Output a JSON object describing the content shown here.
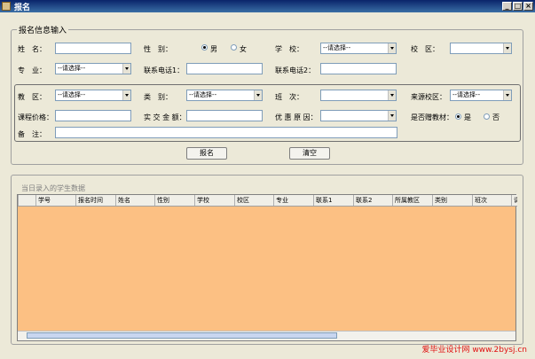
{
  "window": {
    "title": "报名",
    "min": "_",
    "max": "□",
    "close": "×"
  },
  "reg_group": {
    "legend": "报名信息输入"
  },
  "fields": {
    "name_label": "姓　名：",
    "gender_label": "性　别：",
    "gender_male": "男",
    "gender_female": "女",
    "school_label": "学　校：",
    "school_value": "--请选择--",
    "campus_label": "校　区：",
    "campus_value": "",
    "major_label": "专　业：",
    "major_value": "--请选择--",
    "phone1_label": "联系电话1：",
    "phone2_label": "联系电话2：",
    "dept_label": "教　区：",
    "dept_value": "--请选择--",
    "type_label": "类　别：",
    "type_value": "--请选择--",
    "class_label": "班　次：",
    "class_value": "",
    "source_label": "来源校区：",
    "source_value": "--请选择--",
    "price_label": "课程价格：",
    "paid_label": "实 交 金 额：",
    "discount_label": "优 惠 原 因：",
    "discount_value": "",
    "material_label": "是否赠教材：",
    "material_yes": "是",
    "material_no": "否",
    "note_label": "备　注："
  },
  "buttons": {
    "submit": "报名",
    "clear": "清空"
  },
  "list_group": {
    "legend": "当日录入的学生数据"
  },
  "table": {
    "columns": [
      "学号",
      "报名时间",
      "姓名",
      "性别",
      "学校",
      "校区",
      "专业",
      "联系1",
      "联系2",
      "所属教区",
      "类别",
      "班次",
      "课"
    ]
  },
  "watermark": "爱毕业设计网 www.2bysj.cn"
}
